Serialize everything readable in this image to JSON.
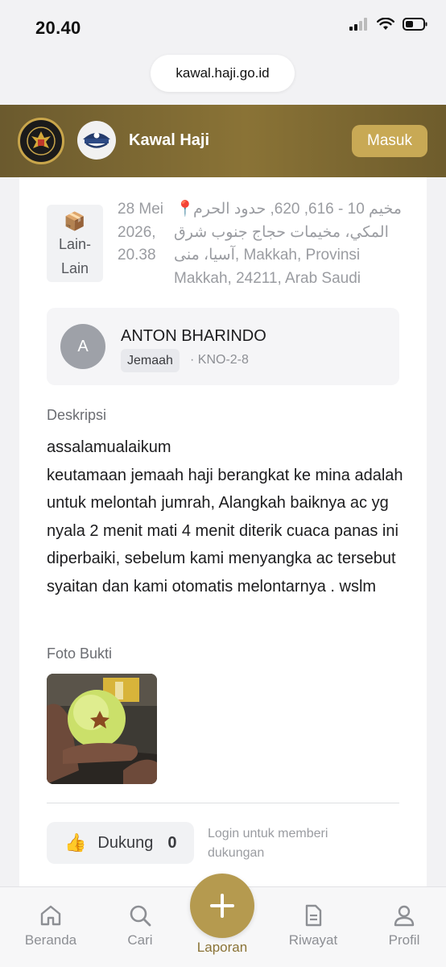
{
  "status_bar": {
    "time": "20.40"
  },
  "browser": {
    "url": "kawal.haji.go.id"
  },
  "header": {
    "title": "Kawal Haji",
    "login_label": "Masuk"
  },
  "report": {
    "category_icon": "📦",
    "category": "Lain-Lain",
    "date": "28 Mei 2026, 20.38",
    "pin_icon": "📍",
    "location": "مخيم 10 - 616, 620, حدود الحرم المكي، مخيمات حجاج جنوب شرق آسيا، منى, Makkah, Provinsi Makkah, 24211, Arab Saudi",
    "reporter": {
      "initial": "A",
      "name": "ANTON BHARINDO",
      "role": "Jemaah",
      "code": "· KNO-2-8"
    },
    "description_label": "Deskripsi",
    "description": "assalamualaikum\nkeutamaan jemaah haji berangkat ke mina adalah untuk melontah jumrah, Alangkah baiknya ac yg nyala 2 menit mati 4 menit diterik cuaca panas ini diperbaiki, sebelum kami menyangka ac tersebut syaitan dan kami otomatis melontarnya . wslm",
    "photo_label": "Foto Bukti",
    "support_icon": "👍",
    "support_label": "Dukung",
    "support_count": "0",
    "login_hint": "Login untuk memberi dukungan"
  },
  "nav": {
    "items": [
      {
        "label": "Beranda",
        "icon": "home-icon"
      },
      {
        "label": "Cari",
        "icon": "search-icon"
      },
      {
        "label": "Laporan",
        "icon": "plus-icon"
      },
      {
        "label": "Riwayat",
        "icon": "document-icon"
      },
      {
        "label": "Profil",
        "icon": "user-icon"
      }
    ]
  },
  "colors": {
    "brand": "#8a7336",
    "accent": "#c8a955",
    "fab": "#b59a4f"
  }
}
